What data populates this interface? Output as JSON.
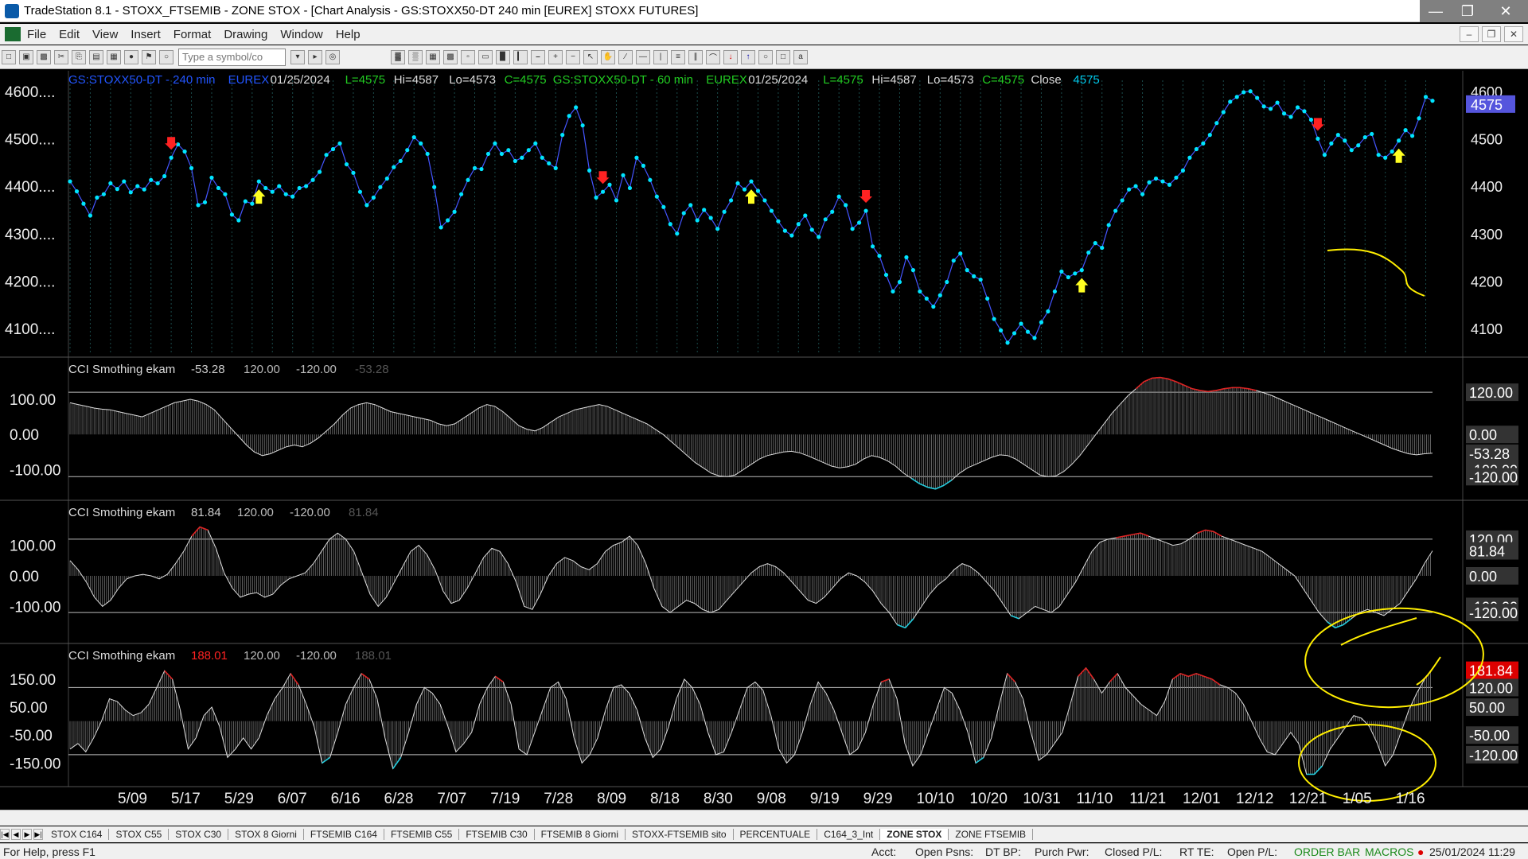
{
  "window": {
    "title": "TradeStation 8.1 - STOXX_FTSEMIB - ZONE STOX - [Chart Analysis - GS:STOXX50-DT  240 min  [EUREX] STOXX FUTURES]"
  },
  "menu": [
    "File",
    "Edit",
    "View",
    "Insert",
    "Format",
    "Drawing",
    "Window",
    "Help"
  ],
  "toolbar": {
    "symbol_placeholder": "Type a symbol/co"
  },
  "price_panel": {
    "header": [
      {
        "text": "GS:STOXX50-DT - 240 min",
        "color": "#2255ff"
      },
      {
        "text": "EUREX",
        "color": "#2255ff"
      },
      {
        "text": "01/25/2024",
        "color": "#dddddd"
      },
      {
        "text": "L=4575",
        "color": "#22cc22"
      },
      {
        "text": "Hi=4587",
        "color": "#dddddd"
      },
      {
        "text": "Lo=4573",
        "color": "#dddddd"
      },
      {
        "text": "C=4575",
        "color": "#22cc22"
      },
      {
        "text": "GS:STOXX50-DT - 60 min",
        "color": "#22cc22"
      },
      {
        "text": "EUREX",
        "color": "#22cc22"
      },
      {
        "text": "01/25/2024",
        "color": "#dddddd"
      },
      {
        "text": "L=4575",
        "color": "#22cc22"
      },
      {
        "text": "Hi=4587",
        "color": "#dddddd"
      },
      {
        "text": "Lo=4573",
        "color": "#dddddd"
      },
      {
        "text": "C=4575",
        "color": "#22cc22"
      },
      {
        "text": "Close",
        "color": "#dddddd"
      },
      {
        "text": "4575",
        "color": "#00ccee"
      }
    ],
    "left_ticks": [
      "4600....",
      "4500....",
      "4400....",
      "4300....",
      "4200....",
      "4100...."
    ],
    "right_ticks": [
      "4600",
      "4500",
      "4400",
      "4300",
      "4200",
      "4100"
    ],
    "last_label": "4575",
    "series_color": "#00e5ff",
    "close": [
      4412,
      4391,
      4365,
      4340,
      4378,
      4385,
      4408,
      4396,
      4412,
      4389,
      4402,
      4395,
      4415,
      4408,
      4423,
      4462,
      4490,
      4475,
      4440,
      4362,
      4368,
      4420,
      4398,
      4385,
      4342,
      4330,
      4370,
      4365,
      4412,
      4398,
      4390,
      4402,
      4385,
      4380,
      4398,
      4402,
      4415,
      4432,
      4468,
      4480,
      4492,
      4448,
      4430,
      4390,
      4362,
      4378,
      4400,
      4418,
      4442,
      4455,
      4478,
      4505,
      4492,
      4470,
      4400,
      4315,
      4330,
      4348,
      4385,
      4415,
      4440,
      4438,
      4470,
      4492,
      4470,
      4478,
      4455,
      4462,
      4478,
      4492,
      4462,
      4450,
      4440,
      4510,
      4550,
      4568,
      4530,
      4435,
      4378,
      4390,
      4405,
      4372,
      4425,
      4398,
      4462,
      4445,
      4415,
      4380,
      4358,
      4322,
      4302,
      4345,
      4362,
      4330,
      4352,
      4335,
      4312,
      4348,
      4372,
      4408,
      4395,
      4412,
      4392,
      4372,
      4350,
      4328,
      4308,
      4298,
      4322,
      4340,
      4310,
      4295,
      4332,
      4348,
      4380,
      4362,
      4312,
      4325,
      4350,
      4275,
      4255,
      4215,
      4180,
      4200,
      4252,
      4225,
      4180,
      4165,
      4148,
      4172,
      4200,
      4245,
      4260,
      4225,
      4212,
      4205,
      4165,
      4122,
      4098,
      4072,
      4092,
      4112,
      4095,
      4082,
      4115,
      4138,
      4180,
      4222,
      4210,
      4218,
      4225,
      4262,
      4282,
      4272,
      4320,
      4350,
      4372,
      4395,
      4402,
      4385,
      4410,
      4418,
      4412,
      4405,
      4420,
      4435,
      4462,
      4480,
      4492,
      4510,
      4535,
      4558,
      4580,
      4590,
      4600,
      4602,
      4588,
      4570,
      4565,
      4578,
      4555,
      4548,
      4568,
      4560,
      4542,
      4502,
      4468,
      4492,
      4510,
      4498,
      4478,
      4488,
      4505,
      4512,
      4468,
      4462,
      4475,
      4498,
      4520,
      4508,
      4545,
      4590,
      4582
    ],
    "arrows_down": [
      15,
      79,
      118,
      185
    ],
    "arrows_up": [
      28,
      101,
      150,
      197
    ],
    "x_labels": [
      "5/09",
      "5/17",
      "5/29",
      "6/07",
      "6/16",
      "6/28",
      "7/07",
      "7/19",
      "7/28",
      "8/09",
      "8/18",
      "8/30",
      "9/08",
      "9/19",
      "9/29",
      "10/10",
      "10/20",
      "10/31",
      "11/10",
      "11/21",
      "12/01",
      "12/12",
      "12/21",
      "1/05",
      "1/16"
    ]
  },
  "cci_panels": [
    {
      "name": "CCI Smothing ekam",
      "value": "-53.28",
      "value_color": "#cccccc",
      "upper": "120.00",
      "lower": "-120.00",
      "faded": "-53.28",
      "left_ticks": [
        "100.00",
        "0.00",
        "-100.00"
      ],
      "right_labels": [
        "120.00",
        "0.00",
        "-53.28",
        "-100.00",
        "-120.00"
      ],
      "ylim": [
        -160,
        170
      ],
      "values": [
        90,
        85,
        80,
        75,
        72,
        70,
        65,
        60,
        55,
        50,
        60,
        70,
        80,
        90,
        95,
        100,
        95,
        85,
        70,
        45,
        20,
        -5,
        -30,
        -50,
        -60,
        -55,
        -45,
        -35,
        -30,
        -35,
        -25,
        -10,
        10,
        30,
        55,
        75,
        85,
        90,
        85,
        75,
        65,
        60,
        55,
        50,
        45,
        40,
        30,
        25,
        30,
        45,
        60,
        75,
        85,
        80,
        65,
        45,
        25,
        15,
        10,
        20,
        35,
        50,
        60,
        70,
        75,
        80,
        85,
        80,
        70,
        60,
        50,
        40,
        30,
        15,
        0,
        -20,
        -40,
        -60,
        -80,
        -95,
        -110,
        -118,
        -120,
        -115,
        -100,
        -85,
        -70,
        -60,
        -55,
        -50,
        -48,
        -52,
        -60,
        -70,
        -80,
        -90,
        -95,
        -92,
        -85,
        -70,
        -60,
        -65,
        -75,
        -90,
        -110,
        -125,
        -140,
        -150,
        -155,
        -145,
        -130,
        -110,
        -95,
        -85,
        -75,
        -65,
        -58,
        -60,
        -70,
        -85,
        -100,
        -115,
        -120,
        -118,
        -105,
        -85,
        -60,
        -30,
        0,
        30,
        60,
        85,
        110,
        130,
        150,
        160,
        162,
        158,
        150,
        140,
        130,
        125,
        122,
        125,
        130,
        133,
        133,
        130,
        125,
        118,
        110,
        100,
        90,
        80,
        70,
        60,
        50,
        40,
        30,
        20,
        10,
        0,
        -10,
        -20,
        -30,
        -40,
        -48,
        -55,
        -58,
        -55,
        -53
      ],
      "pos_color": "#dd2222",
      "neg_color": "#22ccdd"
    },
    {
      "name": "CCI Smothing ekam",
      "value": "81.84",
      "value_color": "#cccccc",
      "upper": "120.00",
      "lower": "-120.00",
      "faded": "81.84",
      "left_ticks": [
        "100.00",
        "0.00",
        "-100.00"
      ],
      "right_labels": [
        "120.00",
        "81.84",
        "0.00",
        "-100.00",
        "-120.00"
      ],
      "ylim": [
        -190,
        190
      ],
      "values": [
        50,
        20,
        -20,
        -70,
        -100,
        -80,
        -40,
        -10,
        0,
        5,
        0,
        -10,
        5,
        40,
        80,
        130,
        160,
        150,
        90,
        10,
        -40,
        -70,
        -60,
        -55,
        -70,
        -60,
        -30,
        -10,
        0,
        10,
        40,
        80,
        120,
        140,
        120,
        80,
        10,
        -60,
        -100,
        -70,
        -20,
        30,
        80,
        100,
        70,
        20,
        -50,
        -90,
        -80,
        -40,
        10,
        60,
        90,
        80,
        40,
        -20,
        -100,
        -110,
        -60,
        0,
        40,
        60,
        50,
        30,
        20,
        40,
        80,
        100,
        110,
        130,
        100,
        40,
        -40,
        -100,
        -120,
        -100,
        -80,
        -90,
        -110,
        -120,
        -110,
        -80,
        -50,
        -20,
        10,
        30,
        40,
        30,
        10,
        -20,
        -50,
        -80,
        -90,
        -70,
        -40,
        -10,
        10,
        0,
        -20,
        -50,
        -90,
        -120,
        -160,
        -170,
        -140,
        -100,
        -60,
        -30,
        -10,
        20,
        40,
        30,
        10,
        -20,
        -50,
        -90,
        -130,
        -140,
        -120,
        -100,
        -110,
        -120,
        -100,
        -60,
        -20,
        30,
        80,
        110,
        120,
        125,
        130,
        135,
        140,
        130,
        120,
        110,
        100,
        105,
        120,
        140,
        150,
        145,
        130,
        120,
        110,
        100,
        90,
        80,
        60,
        40,
        20,
        0,
        -40,
        -80,
        -120,
        -150,
        -170,
        -160,
        -140,
        -120,
        -110,
        -120,
        -130,
        -110,
        -90,
        -50,
        -10,
        40,
        82
      ],
      "pos_color": "#dd2222",
      "neg_color": "#22ccdd"
    },
    {
      "name": "CCI Smothing ekam",
      "value": "188.01",
      "value_color": "#ff2222",
      "upper": "120.00",
      "lower": "-120.00",
      "faded": "188.01",
      "left_ticks": [
        "150.00",
        "50.00",
        "-50.00",
        "-150.00"
      ],
      "right_labels": [
        "181.84",
        "120.00",
        "50.00",
        "-50.00",
        "-120.00"
      ],
      "ylim": [
        -200,
        215
      ],
      "values": [
        -100,
        -80,
        -110,
        -60,
        0,
        80,
        70,
        40,
        20,
        30,
        60,
        120,
        180,
        150,
        40,
        -100,
        -60,
        20,
        50,
        -20,
        -130,
        -100,
        -60,
        -100,
        -60,
        20,
        80,
        120,
        170,
        130,
        60,
        -20,
        -150,
        -130,
        -40,
        60,
        120,
        170,
        150,
        80,
        -60,
        -170,
        -130,
        -40,
        60,
        120,
        100,
        60,
        -20,
        -110,
        -80,
        -40,
        60,
        120,
        160,
        140,
        60,
        -100,
        -120,
        -40,
        40,
        120,
        140,
        80,
        -60,
        -150,
        -120,
        -60,
        40,
        120,
        130,
        100,
        40,
        -60,
        -130,
        -100,
        -20,
        80,
        150,
        120,
        60,
        -40,
        -120,
        -110,
        -40,
        40,
        120,
        140,
        110,
        20,
        -100,
        -150,
        -120,
        -40,
        60,
        140,
        100,
        40,
        -40,
        -120,
        -100,
        -40,
        60,
        140,
        150,
        80,
        -80,
        -160,
        -120,
        -40,
        40,
        120,
        100,
        40,
        -40,
        -150,
        -130,
        -60,
        60,
        170,
        140,
        80,
        -40,
        -140,
        -120,
        -80,
        -40,
        60,
        160,
        190,
        150,
        100,
        140,
        170,
        120,
        90,
        60,
        40,
        20,
        70,
        150,
        170,
        160,
        170,
        160,
        150,
        130,
        120,
        100,
        60,
        0,
        -60,
        -110,
        -120,
        -80,
        -40,
        -80,
        -190,
        -190,
        -160,
        -100,
        -60,
        -20,
        20,
        10,
        -20,
        -80,
        -160,
        -120,
        -40,
        40,
        100,
        150,
        188
      ],
      "pos_color": "#dd2222",
      "neg_color": "#22ccdd"
    }
  ],
  "sheet_tabs": [
    "STOX C164",
    "STOX C55",
    "STOX  C30",
    "STOX  8 Giorni",
    "FTSEMIB C164",
    "FTSEMIB C55",
    "FTSEMIB C30",
    "FTSEMIB  8 Giorni",
    "STOXX-FTSEMIB sito",
    "PERCENTUALE",
    "C164_3_Int",
    "ZONE STOX",
    "ZONE FTSEMIB"
  ],
  "active_tab": "ZONE STOX",
  "status": {
    "help": "For Help, press F1",
    "acct": "Acct:",
    "open_psns": "Open Psns:",
    "dt_bp": "DT BP:",
    "purch_pwr": "Purch Pwr:",
    "closed_pl": "Closed P/L:",
    "rt_te": "RT TE:",
    "open_pl": "Open P/L:",
    "order_bar": "ORDER BAR",
    "macros": "MACROS",
    "datetime": "25/01/2024 11:29"
  }
}
